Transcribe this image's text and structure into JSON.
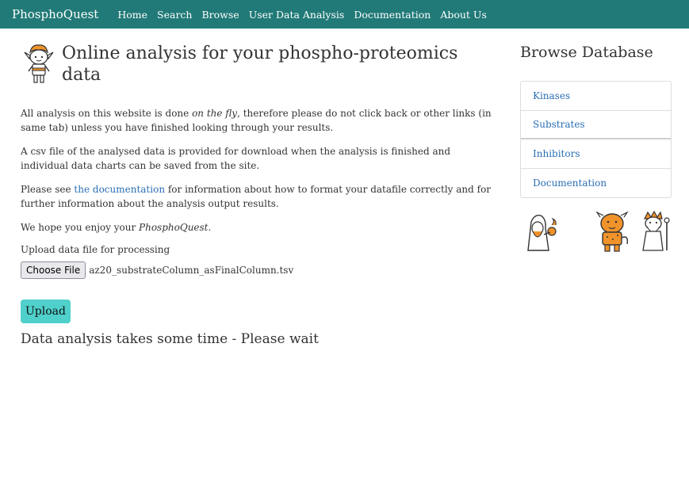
{
  "navbar": {
    "brand": "PhosphoQuest",
    "links": [
      "Home",
      "Search",
      "Browse",
      "User Data Analysis",
      "Documentation",
      "About Us"
    ]
  },
  "main": {
    "title": "Online analysis for your phospho-proteomics data",
    "para1_a": "All analysis on this website is done ",
    "para1_em": "on the fly",
    "para1_b": ", therefore please do not click back or other links (in same tab) unless you have finished looking through your results.",
    "para2": "A csv file of the analysed data is provided for download when the analysis is finished and individual data charts can be saved from the site.",
    "para3_a": "Please see ",
    "para3_link": "the documentation",
    "para3_b": " for information about how to format your datafile correctly and for further information about the analysis output results.",
    "para4_a": "We hope you enjoy your ",
    "para4_em": "PhosphoQuest",
    "para4_b": ".",
    "upload_label": "Upload data file for processing",
    "choose_file_label": "Choose File",
    "file_name": "az20_substrateColumn_asFinalColumn.tsv",
    "upload_button": "Upload",
    "wait_message": "Data analysis takes some time - Please wait"
  },
  "sidebar": {
    "title": "Browse Database",
    "items": [
      "Kinases",
      "Substrates",
      "Inhibitors",
      "Documentation"
    ]
  },
  "colors": {
    "navbar": "#217a78",
    "link": "#2a6fb5",
    "upload_button": "#4fd0cb",
    "mascot_accent": "#f0932b"
  },
  "icons": [
    "adventurer-logo-icon",
    "wizard-icon",
    "lion-warrior-icon",
    "elder-mage-icon"
  ]
}
